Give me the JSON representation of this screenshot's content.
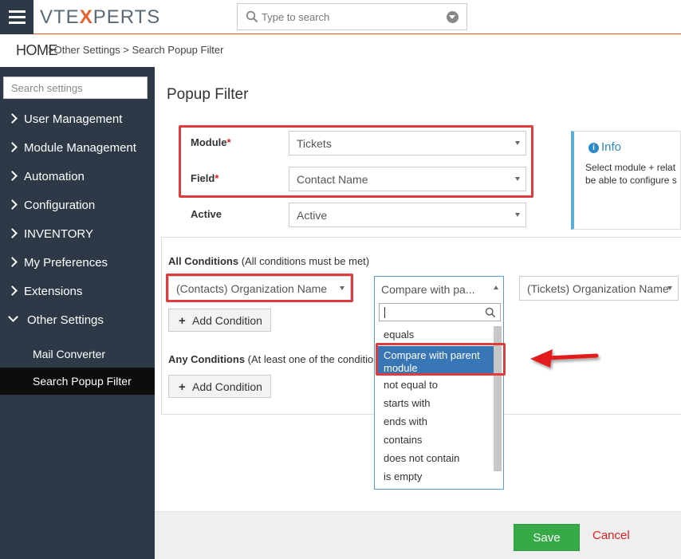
{
  "header": {
    "logo_text_1": "VTE",
    "logo_text_2": "X",
    "logo_text_3": "PERTS",
    "search_placeholder": "Type to search"
  },
  "breadcrumb": {
    "home": "HOME",
    "trail": ">Other Settings >  Search Popup Filter"
  },
  "sidebar": {
    "search_placeholder": "Search settings",
    "items": [
      {
        "label": "User Management"
      },
      {
        "label": "Module Management"
      },
      {
        "label": "Automation"
      },
      {
        "label": "Configuration"
      },
      {
        "label": "INVENTORY"
      },
      {
        "label": "My Preferences"
      },
      {
        "label": "Extensions"
      },
      {
        "label": "Other Settings"
      }
    ],
    "subitems": [
      {
        "label": "Mail Converter"
      },
      {
        "label": "Search Popup Filter"
      }
    ]
  },
  "main": {
    "title": "Popup Filter",
    "module_label": "Module",
    "module_value": "Tickets",
    "field_label": "Field",
    "field_value": "Contact Name",
    "active_label": "Active",
    "active_value": "Active",
    "required_mark": "*",
    "info_title": "Info",
    "info_line1": "Select module + relat",
    "info_line2": "be able to configure s",
    "all_conditions_bold": "All Conditions",
    "all_conditions_note": " (All conditions must be met)",
    "condition_field": "(Contacts) Organization Name",
    "condition_operator": "Compare with pa...",
    "condition_value": "(Tickets) Organization Name",
    "any_conditions_bold": "Any Conditions",
    "any_conditions_note": " (At least one of the conditio",
    "add_condition": "Add Condition"
  },
  "dropdown": {
    "options": [
      "equals",
      "Compare with parent module",
      "not equal to",
      "starts with",
      "ends with",
      "contains",
      "does not contain",
      "is empty"
    ],
    "selected_index": 1
  },
  "footer": {
    "save": "Save",
    "cancel": "Cancel"
  },
  "colors": {
    "sidebar_bg": "#2e3947",
    "accent": "#e8602c",
    "save_green": "#35aa47",
    "highlight_red": "#e03c3c",
    "selected_blue": "#3876b5"
  }
}
